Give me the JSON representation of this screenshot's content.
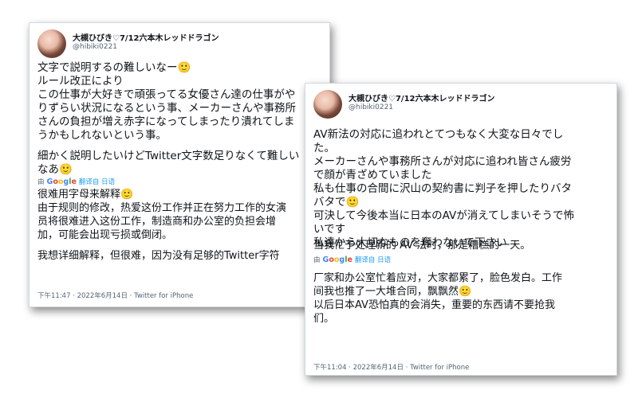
{
  "tweet1": {
    "username": "大槻ひびき♡7/12六本木レッドドラゴン",
    "handle": "@hibiki0221",
    "paragraph1": [
      "文字で説明するの難しいなー🙂",
      "ルール改正により",
      "この仕事が大好きで頑張ってる女優さん達の仕事がや",
      "りずらい状況になるという事、メーカーさんや事務所",
      "さんの負担が増え赤字になってしまったり潰れてしま",
      "うかもしれないという事。"
    ],
    "paragraph2": [
      "細かく説明したいけどTwitter文字数足りなくて難しい",
      "なあ🙂"
    ],
    "translation_by": "由",
    "google_label": "Google",
    "translated_from": "翻译自 日语",
    "translation": [
      "很难用字母来解释🙂",
      "由于规则的修改，热爱这份工作并正在努力工作的女演",
      "员将很难进入这份工作，制造商和办公室的负担会增",
      "加，可能会出现亏损或倒闭。"
    ],
    "translation2": [
      "我想详细解释，但很难，因为没有足够的Twitter字符"
    ],
    "timestamp": "下午11:47 · 2022年6月14日 · Twitter for iPhone"
  },
  "tweet2": {
    "username": "大槻ひびき♡7/12六本木レッドドラゴン",
    "handle": "@hibiki0221",
    "lines": [
      "AV新法の対応に追われとてつもなく大変な日々でし",
      "た。",
      "メーカーさんや事務所さんが対応に追われ皆さん疲労",
      "で顔が青ざめていました",
      "私も仕事の合間に沢山の契約書に判子を押したりバタ",
      "バタで🙂",
      "可決して今後本当に日本のAVが消えてしまいそうで怖",
      "いです",
      "私達から大切なものを奪わないで下さい"
    ],
    "translation_by": "由",
    "google_label": "Google",
    "translated_from": "翻译自 日语",
    "translation": [
      "当我忙于处理新的 AV 法时，那是糟糕的一天。",
      "厂家和办公室忙着应对，大家都累了，脸色发白。工作",
      "间我也推了一大堆合同，飘飘然🙂",
      "以后日本AV恐怕真的会消失，重要的东西请不要抢我",
      "们。"
    ],
    "timestamp": "下午11:04 · 2022年6月14日 · Twitter for iPhone"
  }
}
